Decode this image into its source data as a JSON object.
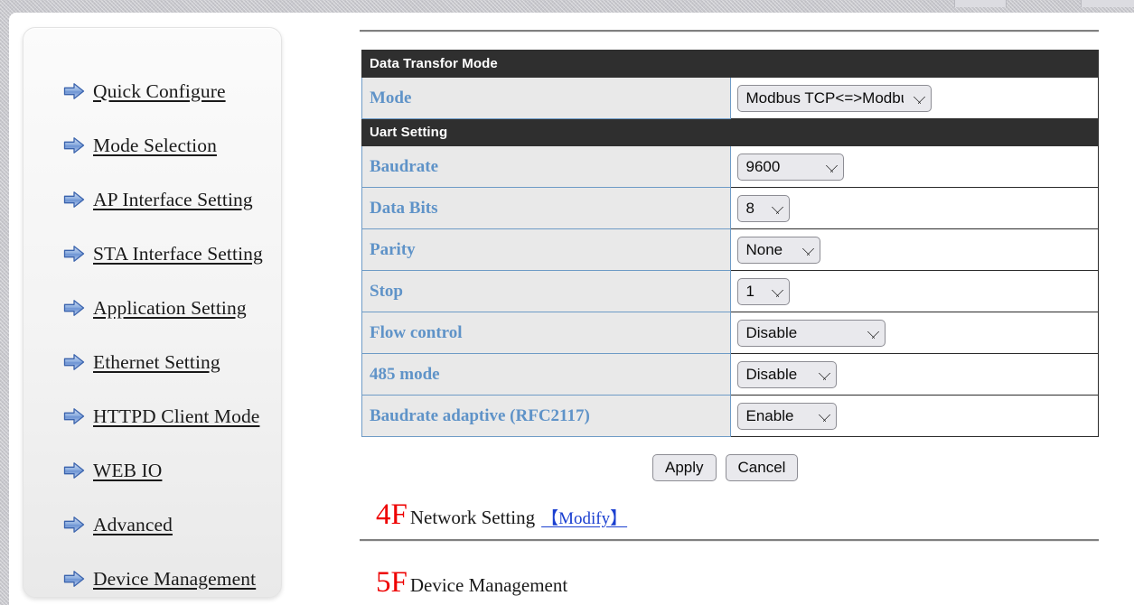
{
  "browser": {
    "tab_stubs": 2
  },
  "sidebar": {
    "items": [
      {
        "label": "Quick Configure",
        "icon": "arrow-right-icon"
      },
      {
        "label": "Mode Selection",
        "icon": "arrow-right-icon"
      },
      {
        "label": "AP Interface Setting",
        "icon": "arrow-right-icon"
      },
      {
        "label": "STA Interface Setting",
        "icon": "arrow-right-icon"
      },
      {
        "label": "Application Setting",
        "icon": "arrow-right-icon"
      },
      {
        "label": "Ethernet Setting",
        "icon": "arrow-right-icon"
      },
      {
        "label": "HTTPD Client Mode",
        "icon": "arrow-right-icon"
      },
      {
        "label": "WEB IO",
        "icon": "arrow-right-icon"
      },
      {
        "label": "Advanced",
        "icon": "arrow-right-icon"
      },
      {
        "label": "Device Management",
        "icon": "arrow-right-icon"
      }
    ]
  },
  "main": {
    "sections": [
      {
        "header": "Data Transfor Mode",
        "rows": [
          {
            "label": "Mode",
            "control": "select",
            "value": "Modbus TCP<=>Modbus RTU",
            "options": [
              "Modbus TCP<=>Modbus RTU"
            ]
          }
        ]
      },
      {
        "header": "Uart Setting",
        "rows": [
          {
            "label": "Baudrate",
            "control": "select",
            "value": "9600",
            "options": [
              "9600"
            ]
          },
          {
            "label": "Data Bits",
            "control": "select",
            "value": "8",
            "options": [
              "8"
            ]
          },
          {
            "label": "Parity",
            "control": "select",
            "value": "None",
            "options": [
              "None"
            ]
          },
          {
            "label": "Stop",
            "control": "select",
            "value": "1",
            "options": [
              "1"
            ]
          },
          {
            "label": "Flow control",
            "control": "select",
            "value": "Disable",
            "options": [
              "Disable"
            ]
          },
          {
            "label": "485 mode",
            "control": "select",
            "value": "Disable",
            "options": [
              "Disable"
            ]
          },
          {
            "label": "Baudrate adaptive (RFC2117)",
            "control": "select",
            "value": "Enable",
            "options": [
              "Enable"
            ]
          }
        ]
      }
    ],
    "buttons": {
      "apply": "Apply",
      "cancel": "Cancel"
    },
    "footer_sections": [
      {
        "number": "4F",
        "title": "Network Setting",
        "link": "【Modify】"
      },
      {
        "number": "5F",
        "title": "Device Management",
        "link": ""
      }
    ]
  },
  "colors": {
    "section_header_bg": "#2f2f2f",
    "section_header_text": "#ffffff",
    "label_text": "#5f93c8",
    "label_bg": "#e9e9e9",
    "label_border": "#6e9bc6",
    "value_border": "#2b2b2b",
    "accent_red": "#ee0000",
    "link_blue": "#1a3fd0",
    "arrow_icon": "#4b79c4",
    "page_bg": "#ffffff",
    "gutter_bg": "#c7c7cc"
  }
}
